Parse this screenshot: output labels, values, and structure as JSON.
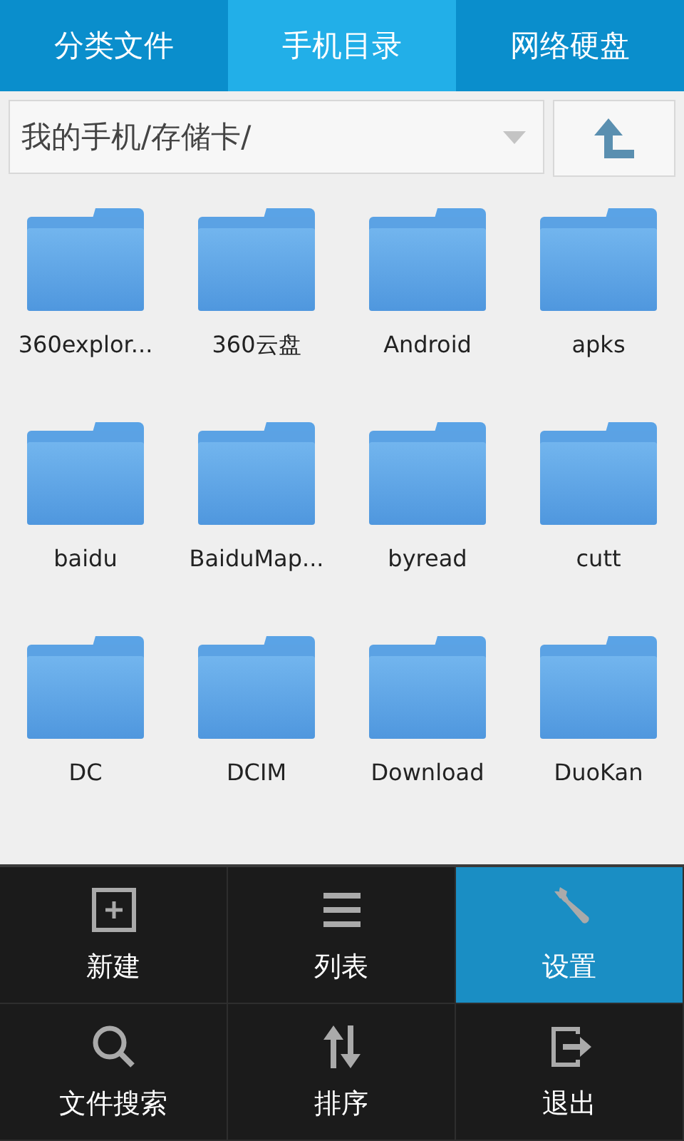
{
  "tabs": [
    {
      "label": "分类文件",
      "selected": false
    },
    {
      "label": "手机目录",
      "selected": true
    },
    {
      "label": "网络硬盘",
      "selected": false
    }
  ],
  "path_bar": {
    "path": "我的手机/存储卡/"
  },
  "folders": [
    {
      "name": "360explor..."
    },
    {
      "name": "360云盘"
    },
    {
      "name": "Android"
    },
    {
      "name": "apks"
    },
    {
      "name": "baidu"
    },
    {
      "name": "BaiduMap..."
    },
    {
      "name": "byread"
    },
    {
      "name": "cutt"
    },
    {
      "name": "DC"
    },
    {
      "name": "DCIM"
    },
    {
      "name": "Download"
    },
    {
      "name": "DuoKan"
    }
  ],
  "menu": {
    "items": [
      {
        "label": "新建",
        "selected": false
      },
      {
        "label": "列表",
        "selected": false
      },
      {
        "label": "设置",
        "selected": true
      },
      {
        "label": "文件搜索",
        "selected": false
      },
      {
        "label": "排序",
        "selected": false
      },
      {
        "label": "退出",
        "selected": false
      }
    ]
  }
}
